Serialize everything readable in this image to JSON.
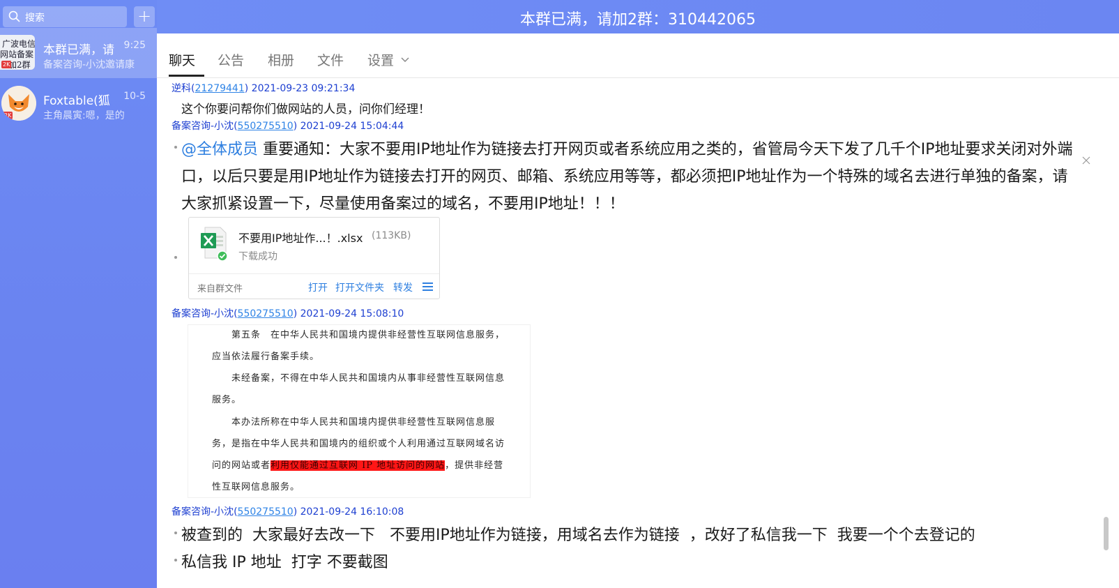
{
  "sidebar": {
    "search_placeholder": "搜索",
    "add_label": "+",
    "conversations": [
      {
        "title": "本群已满，请",
        "time": "9:25",
        "preview": "备案咨询-小沈邀请康",
        "avatar_lines": [
          "广波电信",
          "网站备案",
          "加2群"
        ],
        "badge": "2K"
      },
      {
        "title": "Foxtable(狐",
        "time": "10-5",
        "preview": "主角晨寅:嗯，是的",
        "badge": "2K"
      }
    ]
  },
  "header": {
    "title": "本群已满，请加2群：310442065"
  },
  "tabs": [
    {
      "label": "聊天"
    },
    {
      "label": "公告"
    },
    {
      "label": "相册"
    },
    {
      "label": "文件"
    },
    {
      "label": "设置"
    }
  ],
  "messages": [
    {
      "sender": "逆科",
      "uid": "21279441",
      "time": "2021-09-23 09:21:34",
      "text": "这个你要问帮你们做网站的人员，问你们经理！"
    },
    {
      "sender": "备案咨询-小沈",
      "uid": "550275510",
      "time": "2021-09-24 15:04:44",
      "mention": "@全体成员",
      "text": " 重要通知：大家不要用IP地址作为链接去打开网页或者系统应用之类的，省管局今天下发了几千个IP地址要求关闭对外端口，以后只要是用IP地址作为链接去打开的网页、邮箱、系统应用等等，都必须把IP地址作为一个特殊的域名去进行单独的备案，请大家抓紧设置一下，尽量使用备案过的域名，不要用IP地址！！！",
      "file": {
        "name": "不要用IP地址作...！.xlsx",
        "size": "(113KB)",
        "status": "下载成功",
        "source": "来自群文件",
        "actions": [
          "打开",
          "打开文件夹",
          "转发"
        ]
      }
    },
    {
      "sender": "备案咨询-小沈",
      "uid": "550275510",
      "time": "2021-09-24 15:08:10",
      "doc_lines": [
        "　　第五条　在中华人民共和国境内提供非经营性互联网信息服务，",
        "应当依法履行备案手续。",
        "　　未经备案，不得在中华人民共和国境内从事非经营性互联网信息",
        "服务。",
        "　　本办法所称在中华人民共和国境内提供非经营性互联网信息服",
        "务，是指在中华人民共和国境内的组织或个人利用通过互联网域名访",
        "问的网站或者",
        "性互联网信息服务。"
      ],
      "doc_highlight": "利用仅能通过互联网 IP 地址访问的网站",
      "doc_after_highlight": "，提供非经营"
    },
    {
      "sender": "备案咨询-小沈",
      "uid": "550275510",
      "time": "2021-09-24 16:10:08",
      "lines": [
        "被查到的  大家最好去改一下   不要用IP地址作为链接，用域名去作为链接  ，改好了私信我一下  我要一个个去登记的",
        "私信我 IP 地址  打字 不要截图"
      ]
    }
  ],
  "colors": {
    "sidebar": "#6d8bf4",
    "link": "#2e7fe0",
    "meta": "#1d3fd1",
    "highlight": "#ff1616"
  }
}
